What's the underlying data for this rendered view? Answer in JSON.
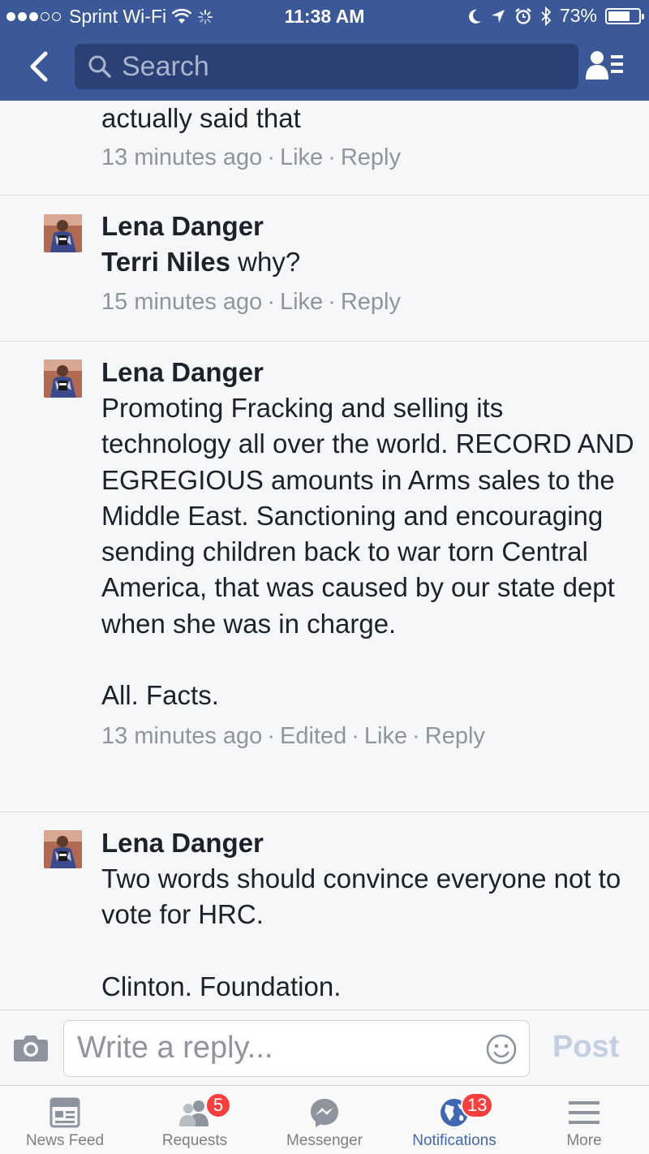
{
  "status_bar": {
    "carrier": "Sprint Wi-Fi",
    "time": "11:38 AM",
    "battery": "73%",
    "battery_level": 0.73
  },
  "nav": {
    "search_placeholder": "Search"
  },
  "comments": [
    {
      "text": "actually said that",
      "time": "13 minutes ago",
      "like": "Like",
      "reply": "Reply"
    },
    {
      "author": "Lena Danger",
      "mention": "Terri Niles",
      "text": "why?",
      "time": "15 minutes ago",
      "like": "Like",
      "reply": "Reply"
    },
    {
      "author": "Lena Danger",
      "text": "Promoting Fracking and selling its technology all over the world. RECORD AND EGREGIOUS amounts in Arms sales to the Middle East. Sanctioning and encouraging sending children back to war torn Central America, that was caused by our state dept when she was in charge.\n\nAll. Facts.",
      "time": "13 minutes ago",
      "edited": "Edited",
      "like": "Like",
      "reply": "Reply"
    },
    {
      "author": "Lena Danger",
      "text": "Two words should convince everyone not to vote for HRC.\n\nClinton. Foundation.",
      "time": "",
      "like": "",
      "reply": ""
    }
  ],
  "composer": {
    "placeholder": "Write a reply...",
    "post_label": "Post"
  },
  "tabs": [
    {
      "label": "News Feed",
      "icon": "news-feed-icon"
    },
    {
      "label": "Requests",
      "icon": "friend-requests-icon",
      "badge": "5"
    },
    {
      "label": "Messenger",
      "icon": "messenger-icon"
    },
    {
      "label": "Notifications",
      "icon": "globe-icon",
      "badge": "13",
      "active": true
    },
    {
      "label": "More",
      "icon": "menu-icon"
    }
  ],
  "colors": {
    "brand": "#3b5998",
    "active_tab": "#4267b2",
    "badge": "#fa3e3e"
  }
}
